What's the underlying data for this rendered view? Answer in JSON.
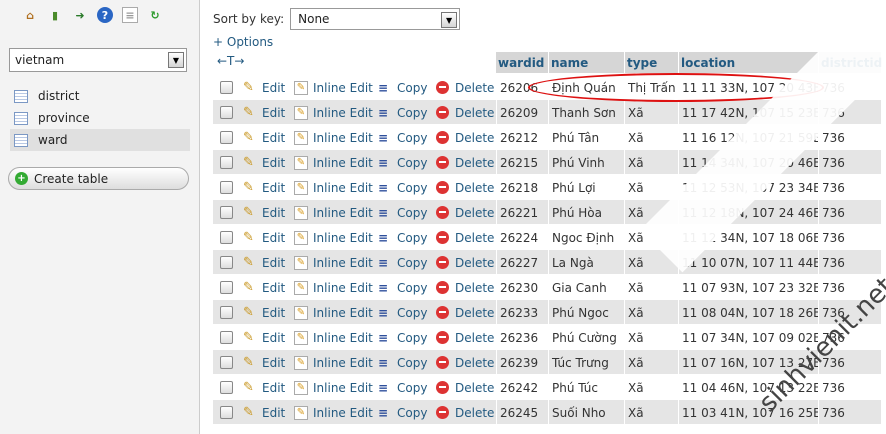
{
  "sidebar": {
    "db_selected": "vietnam",
    "tables": [
      {
        "name": "district"
      },
      {
        "name": "province"
      },
      {
        "name": "ward"
      }
    ],
    "create_table_label": "Create table"
  },
  "toolbar": {
    "sort_label": "Sort by key:",
    "sort_value": "None",
    "options_label": "+ Options"
  },
  "table": {
    "columns": [
      "wardid",
      "name",
      "type",
      "location",
      "districtid"
    ],
    "arrows": "←T→",
    "actions": {
      "edit": "Edit",
      "inline_edit": "Inline Edit",
      "copy": "Copy",
      "delete": "Delete"
    },
    "rows": [
      {
        "wardid": "26206",
        "name": "Định Quán",
        "type": "Thị Trấn",
        "location": "11 11 33N, 107 20 43E",
        "districtid": "736"
      },
      {
        "wardid": "26209",
        "name": "Thanh Sơn",
        "type": "Xã",
        "location": "11 17 42N, 107 15 23E",
        "districtid": "736"
      },
      {
        "wardid": "26212",
        "name": "Phú Tân",
        "type": "Xã",
        "location": "11 16 12N, 107 21 59E",
        "districtid": "736"
      },
      {
        "wardid": "26215",
        "name": "Phú Vinh",
        "type": "Xã",
        "location": "11 14 34N, 107 20 46E",
        "districtid": "736"
      },
      {
        "wardid": "26218",
        "name": "Phú Lợi",
        "type": "Xã",
        "location": "11 12 53N, 107 23 34E",
        "districtid": "736"
      },
      {
        "wardid": "26221",
        "name": "Phú Hòa",
        "type": "Xã",
        "location": "11 12 18N, 107 24 46E",
        "districtid": "736"
      },
      {
        "wardid": "26224",
        "name": "Ngoc Định",
        "type": "Xã",
        "location": "11 12 34N, 107 18 06E",
        "districtid": "736"
      },
      {
        "wardid": "26227",
        "name": "La Ngà",
        "type": "Xã",
        "location": "11 10 07N, 107 11 44E",
        "districtid": "736"
      },
      {
        "wardid": "26230",
        "name": "Gia Canh",
        "type": "Xã",
        "location": "11 07 93N, 107 23 32E",
        "districtid": "736"
      },
      {
        "wardid": "26233",
        "name": "Phú Ngoc",
        "type": "Xã",
        "location": "11 08 04N, 107 18 26E",
        "districtid": "736"
      },
      {
        "wardid": "26236",
        "name": "Phú Cường",
        "type": "Xã",
        "location": "11 07 34N, 107 09 02E",
        "districtid": "736"
      },
      {
        "wardid": "26239",
        "name": "Túc Trưng",
        "type": "Xã",
        "location": "11 07 16N, 107 13 27E",
        "districtid": "736"
      },
      {
        "wardid": "26242",
        "name": "Phú Túc",
        "type": "Xã",
        "location": "11 04 46N, 107 13 22E",
        "districtid": "736"
      },
      {
        "wardid": "26245",
        "name": "Suối Nho",
        "type": "Xã",
        "location": "11 03 41N, 107 16 25E",
        "districtid": "736"
      }
    ]
  },
  "watermark": "sinhvienit.net",
  "colors": {
    "link": "#235a81",
    "highlight": "#dd1111",
    "header_bg": "#d6d6d6",
    "row_alt_bg": "#e5e5e5"
  }
}
